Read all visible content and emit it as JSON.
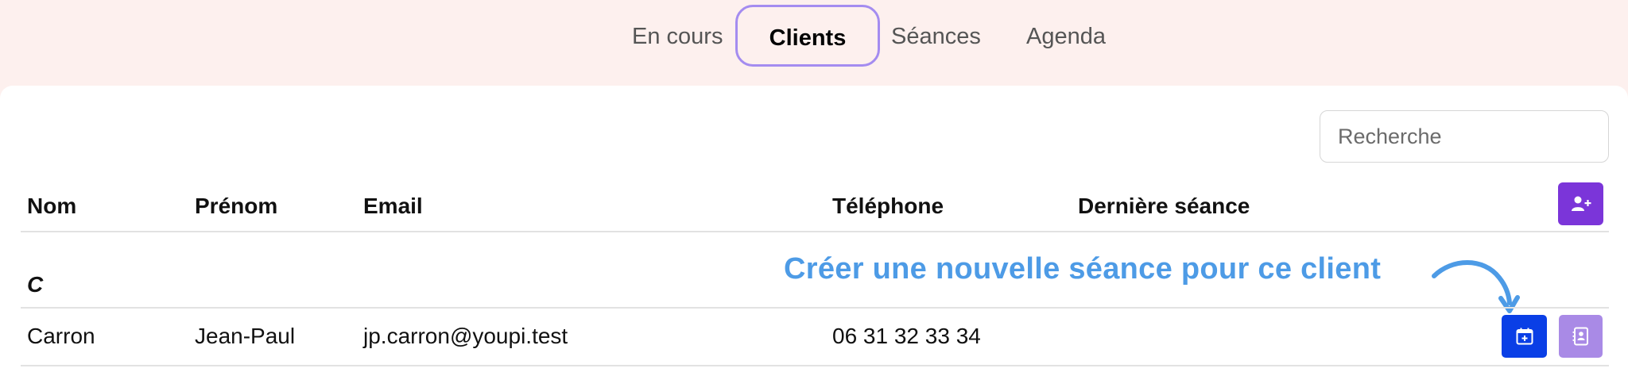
{
  "nav": {
    "tabs": [
      {
        "label": "En cours",
        "active": false
      },
      {
        "label": "Clients",
        "active": true
      },
      {
        "label": "Séances",
        "active": false
      },
      {
        "label": "Agenda",
        "active": false
      }
    ]
  },
  "search": {
    "placeholder": "Recherche"
  },
  "table": {
    "headers": [
      "Nom",
      "Prénom",
      "Email",
      "Téléphone",
      "Dernière séance"
    ],
    "groups": [
      {
        "letter": "C",
        "rows": [
          {
            "nom": "Carron",
            "prenom": "Jean-Paul",
            "email": "jp.carron@youpi.test",
            "telephone": "06 31 32 33 34",
            "derniere_seance": ""
          }
        ]
      }
    ]
  },
  "annotation": {
    "text": "Créer une nouvelle séance pour ce client"
  },
  "icons": {
    "add_client": "user-plus-icon",
    "new_session": "calendar-plus-icon",
    "contact": "address-book-icon"
  },
  "colors": {
    "nav_background": "#fdf0ee",
    "active_tab_border": "#a48cf0",
    "add_client_button": "#7b35d9",
    "new_session_button": "#0a3fe6",
    "contact_button": "#a98ae6",
    "annotation": "#4d9be6"
  }
}
